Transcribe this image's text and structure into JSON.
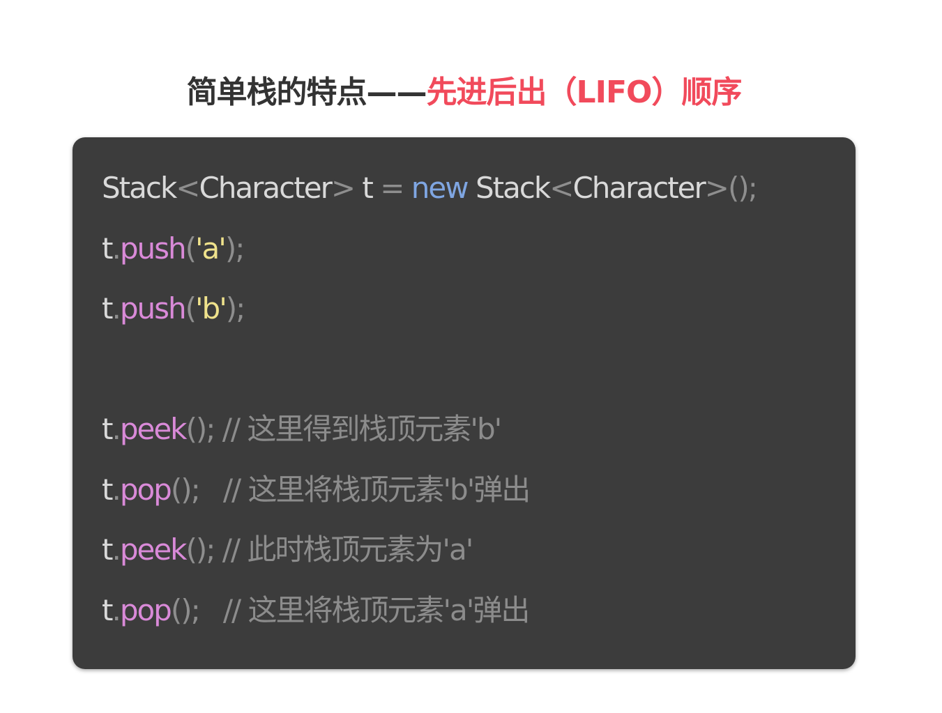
{
  "title": {
    "prefix": "简单栈的特点——",
    "highlight": "先进后出（LIFO）顺序"
  },
  "colors": {
    "card_bg": "#3c3c3c",
    "highlight": "#f14a5b",
    "keyword": "#7fa6e2",
    "method": "#d98ad8",
    "string": "#efe28c"
  },
  "code": {
    "lines": [
      {
        "tokens": [
          {
            "t": "plain",
            "v": "Stack"
          },
          {
            "t": "punct",
            "v": "<"
          },
          {
            "t": "plain",
            "v": "Character"
          },
          {
            "t": "punct",
            "v": ">"
          },
          {
            "t": "plain",
            "v": " t "
          },
          {
            "t": "punct",
            "v": "="
          },
          {
            "t": "plain",
            "v": " "
          },
          {
            "t": "keyword",
            "v": "new"
          },
          {
            "t": "plain",
            "v": " Stack"
          },
          {
            "t": "punct",
            "v": "<"
          },
          {
            "t": "plain",
            "v": "Character"
          },
          {
            "t": "punct",
            "v": ">();"
          }
        ]
      },
      {
        "tokens": [
          {
            "t": "plain",
            "v": "t"
          },
          {
            "t": "punct",
            "v": "."
          },
          {
            "t": "method",
            "v": "push"
          },
          {
            "t": "punct",
            "v": "("
          },
          {
            "t": "string",
            "v": "'a'"
          },
          {
            "t": "punct",
            "v": ");"
          }
        ]
      },
      {
        "tokens": [
          {
            "t": "plain",
            "v": "t"
          },
          {
            "t": "punct",
            "v": "."
          },
          {
            "t": "method",
            "v": "push"
          },
          {
            "t": "punct",
            "v": "("
          },
          {
            "t": "string",
            "v": "'b'"
          },
          {
            "t": "punct",
            "v": ");"
          }
        ]
      },
      {
        "tokens": []
      },
      {
        "tokens": [
          {
            "t": "plain",
            "v": "t"
          },
          {
            "t": "punct",
            "v": "."
          },
          {
            "t": "method",
            "v": "peek"
          },
          {
            "t": "punct",
            "v": "(); "
          },
          {
            "t": "comment",
            "v": "// 这里得到栈顶元素'b'"
          }
        ]
      },
      {
        "tokens": [
          {
            "t": "plain",
            "v": "t"
          },
          {
            "t": "punct",
            "v": "."
          },
          {
            "t": "method",
            "v": "pop"
          },
          {
            "t": "punct",
            "v": "();   "
          },
          {
            "t": "comment",
            "v": "// 这里将栈顶元素'b'弹出"
          }
        ]
      },
      {
        "tokens": [
          {
            "t": "plain",
            "v": "t"
          },
          {
            "t": "punct",
            "v": "."
          },
          {
            "t": "method",
            "v": "peek"
          },
          {
            "t": "punct",
            "v": "(); "
          },
          {
            "t": "comment",
            "v": "// 此时栈顶元素为'a'"
          }
        ]
      },
      {
        "tokens": [
          {
            "t": "plain",
            "v": "t"
          },
          {
            "t": "punct",
            "v": "."
          },
          {
            "t": "method",
            "v": "pop"
          },
          {
            "t": "punct",
            "v": "();   "
          },
          {
            "t": "comment",
            "v": "// 这里将栈顶元素'a'弹出"
          }
        ]
      }
    ]
  }
}
